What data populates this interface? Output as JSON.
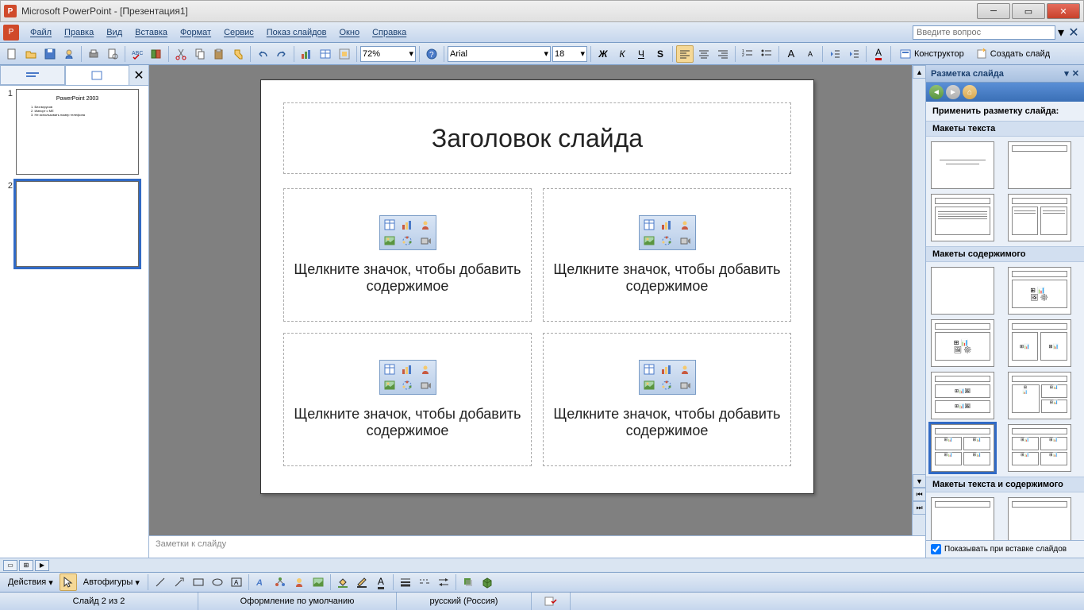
{
  "titlebar": {
    "text": "Microsoft PowerPoint - [Презентация1]"
  },
  "menu": {
    "items": [
      "Файл",
      "Правка",
      "Вид",
      "Вставка",
      "Формат",
      "Сервис",
      "Показ слайдов",
      "Окно",
      "Справка"
    ],
    "help_placeholder": "Введите вопрос"
  },
  "toolbar": {
    "zoom": "72%",
    "font": "Arial",
    "fontsize": "18",
    "designer": "Конструктор",
    "new_slide": "Создать слайд"
  },
  "slides": {
    "thumb1_title": "PowerPoint 2003",
    "thumb1_lines": [
      "1. Без вирусов",
      "2. Импорт с ME",
      "3. Не использовать номер телефона"
    ]
  },
  "editor": {
    "title_placeholder": "Заголовок слайда",
    "content_placeholder": "Щелкните значок, чтобы добавить содержимое"
  },
  "notes": {
    "placeholder": "Заметки к слайду"
  },
  "taskpane": {
    "title": "Разметка слайда",
    "apply_label": "Применить разметку слайда:",
    "section_text": "Макеты текста",
    "section_content": "Макеты содержимого",
    "section_text_content": "Макеты текста и содержимого",
    "footer_check": "Показывать при вставке слайдов"
  },
  "drawbar": {
    "actions": "Действия",
    "autoshapes": "Автофигуры"
  },
  "status": {
    "slide": "Слайд 2 из 2",
    "design": "Оформление по умолчанию",
    "lang": "русский (Россия)"
  }
}
